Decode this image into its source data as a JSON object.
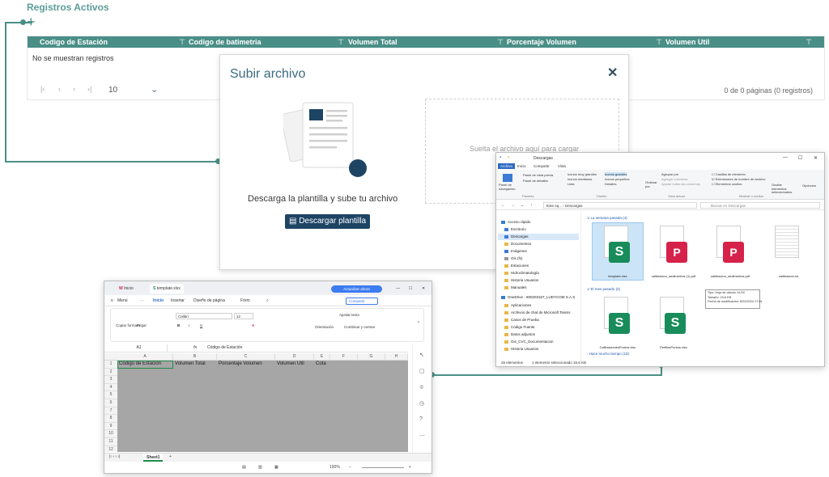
{
  "page": {
    "title": "Registros Activos",
    "columns": [
      "Codigo de Estación",
      "Codigo de batimetria",
      "Volumen Total",
      "Porcentaje Volumen",
      "Volumen Util"
    ],
    "no_records": "No se muestran registros",
    "page_size": "10",
    "page_info": "0 de 0 páginas (0 registros)"
  },
  "modal": {
    "title": "Subir archivo",
    "subtitle": "Descarga la plantilla y sube tu archivo",
    "download_label": "Descargar plantilla",
    "drop_text": "Suelta el archivo aquí para cargar"
  },
  "explorer": {
    "title": "Descargas",
    "tabs": [
      "Archivo",
      "Inicio",
      "Compartir",
      "Vista"
    ],
    "ribbon": {
      "panel_nav": "Panel de navegación",
      "panel_vista": "Panel de vista previa",
      "panel_detalles": "Panel de detalles",
      "iconos_muy_grandes": "Iconos muy grandes",
      "iconos_grandes": "Iconos grandes",
      "iconos_medianos": "Iconos medianos",
      "iconos_pequenos": "Iconos pequeños",
      "lista": "Lista",
      "detalles": "Detalles",
      "ordenar": "Ordenar por",
      "agrupar": "Agrupar por",
      "agregar_cols": "Agregar columnas",
      "ajustar": "Ajustar todas las columnas",
      "casillas": "Casillas de elemento",
      "extensiones": "Extensiones de nombre de archivo",
      "ocultos": "Elementos ocultos",
      "ocultar_sel": "Ocultar elementos seleccionados",
      "opciones": "Opciones",
      "grp_paneles": "Paneles",
      "grp_diseno": "Diseño",
      "grp_vista": "Vista actual",
      "grp_mostrar": "Mostrar u ocultar"
    },
    "address": "Este eq... › Descargas",
    "search_placeholder": "Buscar en Descargas",
    "nav": [
      "Acceso rápido",
      "Escritorio",
      "Descargas",
      "Documentos",
      "Imágenes",
      "Gis (fs)",
      "Estaciones",
      "Hidroclimatología",
      "Historia Usuarios",
      "Manuales",
      "OneDrive - 800203167_LUDYCOM S.A.S",
      "Aplicaciones",
      "Archivos de chat de Microsoft Teams",
      "Casos de Prueba",
      "Código Fuente",
      "Datos adjuntos",
      "Gis_CVC_Documentacion",
      "Historia Usuarios"
    ],
    "group_last_week": "La semana pasada (4)",
    "group_last_month": "El mes pasado (2)",
    "group_long_ago": "Hace mucho tiempo (19)",
    "files_week": [
      "template.xlsx",
      "calibracion_sedimentos (1).pdf",
      "calibracion_sedimentos.pdf",
      "calibracion.txt"
    ],
    "files_month": [
      "CalibracionesPuntos.xlsx",
      "PerfilesPuntos.xlsx"
    ],
    "tooltip": {
      "type": "Tipo: Hoja de cálculo XLSX",
      "size": "Tamaño: 15,6 KB",
      "date": "Fecha de modificación: 8/02/2024 17:01"
    },
    "status_count": "25 elementos",
    "status_selected": "1 elemento seleccionado 15,6 KB"
  },
  "spreadsheet": {
    "tab_home": "Inicio",
    "tab_file": "template.xlsx",
    "upgrade": "Actualizar ahora",
    "menu": [
      "Menú",
      "Inicio",
      "Insertar",
      "Diseño de página",
      "Fórm"
    ],
    "share": "Compartir",
    "copy_format": "Copiar formato",
    "paste": "Pegar",
    "font": "Calibri",
    "font_size": "12",
    "wrap": "Ajustar texto",
    "orientation": "Orientación",
    "merge": "Combinar y centrar",
    "cell_ref": "A1",
    "fx": "fx",
    "formula": "Código de Estación",
    "col_letters": [
      "A",
      "B",
      "C",
      "D",
      "E",
      "F",
      "G",
      "H"
    ],
    "rows": [
      "1",
      "2",
      "3",
      "4",
      "5",
      "6",
      "7",
      "8",
      "9",
      "10",
      "11",
      "12"
    ],
    "headers": [
      "Código de Estación",
      "Volumen Total",
      "Porcentaje Volumen",
      "Volumen Util",
      "Cota"
    ],
    "sheet": "Sheet1",
    "zoom": "100%"
  }
}
